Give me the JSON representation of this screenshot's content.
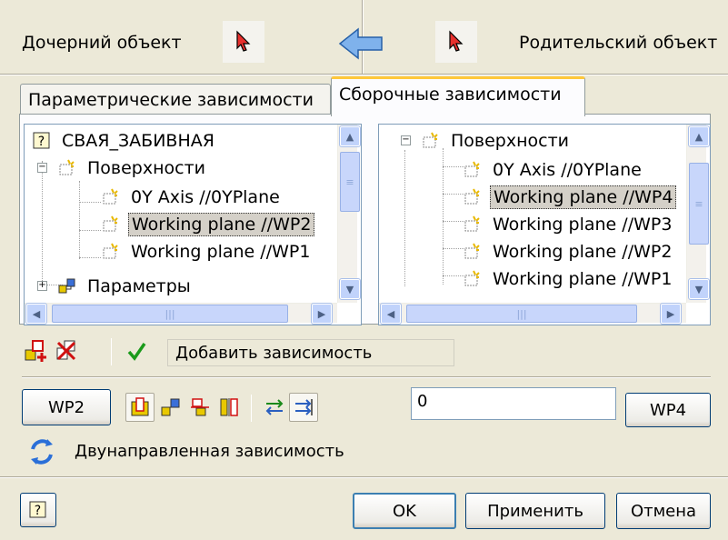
{
  "header": {
    "child_label": "Дочерний объект",
    "parent_label": "Родительский объект"
  },
  "tabs": [
    {
      "label": "Параметрические зависимости",
      "active": false
    },
    {
      "label": "Сборочные зависимости",
      "active": true
    }
  ],
  "left_tree": {
    "root": "СВАЯ_ЗАБИВНАЯ",
    "group": "Поверхности",
    "items": [
      "0Y Axis //0YPlane",
      "Working plane //WP2",
      "Working plane //WP1"
    ],
    "selected": "Working plane //WP2",
    "next_group": "Параметры"
  },
  "right_tree": {
    "group": "Поверхности",
    "items": [
      "0Y Axis //0YPlane",
      "Working plane //WP4",
      "Working plane //WP3",
      "Working plane //WP2",
      "Working plane //WP1"
    ],
    "selected": "Working plane //WP4"
  },
  "toolbar": {
    "status_text": "Добавить зависимость"
  },
  "constraint": {
    "child_button": "WP2",
    "value": "0",
    "parent_button": "WP4",
    "direction_label": "Двунаправленная зависимость"
  },
  "footer": {
    "ok": "OK",
    "apply": "Применить",
    "cancel": "Отмена"
  },
  "icons": {
    "pick_child": "pick-arrow-icon",
    "direction": "blue-left-arrow-icon",
    "pick_parent": "pick-arrow-icon",
    "help": "help-icon"
  },
  "colors": {
    "window_bg": "#ece9d8",
    "tab_active_accent": "#ffc83c",
    "selection_bg": "#d4d0c8",
    "button_border": "#003c74"
  }
}
